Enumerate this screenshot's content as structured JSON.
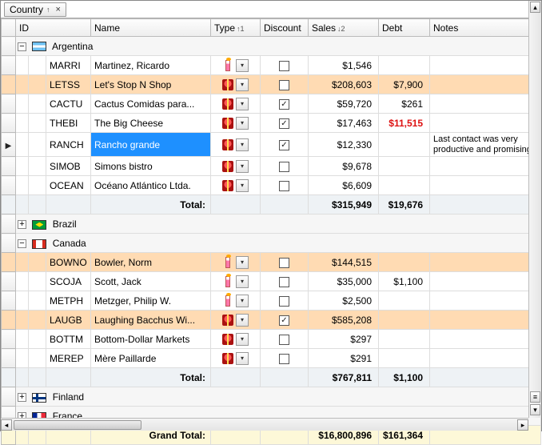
{
  "groupby": {
    "label": "Country",
    "sort_glyph": "↑",
    "close_glyph": "×"
  },
  "columns": {
    "id": "ID",
    "name": "Name",
    "type": "Type",
    "discount": "Discount",
    "sales": "Sales",
    "debt": "Debt",
    "notes": "Notes",
    "type_sort": "↑1",
    "sales_sort": "↓2"
  },
  "groups": {
    "argentina": {
      "name": "Argentina",
      "expanded": true
    },
    "brazil": {
      "name": "Brazil",
      "expanded": false
    },
    "canada": {
      "name": "Canada",
      "expanded": true
    },
    "finland": {
      "name": "Finland",
      "expanded": false
    },
    "france": {
      "name": "France",
      "expanded": false
    }
  },
  "rows": {
    "ar": [
      {
        "id": "MARRI",
        "name": "Martinez, Ricardo",
        "type": "candle",
        "discount": false,
        "sales": "$1,546",
        "debt": "",
        "notes": ""
      },
      {
        "id": "LETSS",
        "name": "Let's Stop N Shop",
        "type": "gift",
        "discount": false,
        "sales": "$208,603",
        "debt": "$7,900",
        "notes": ""
      },
      {
        "id": "CACTU",
        "name": "Cactus Comidas para...",
        "type": "gift",
        "discount": true,
        "sales": "$59,720",
        "debt": "$261",
        "notes": ""
      },
      {
        "id": "THEBI",
        "name": "The Big Cheese",
        "type": "gift",
        "discount": true,
        "sales": "$17,463",
        "debt": "$11,515",
        "debt_red": true,
        "notes": ""
      },
      {
        "id": "RANCH",
        "name": "Rancho grande",
        "type": "gift",
        "discount": true,
        "sales": "$12,330",
        "debt": "",
        "notes": "Last contact was very productive and promising",
        "selected": true
      },
      {
        "id": "SIMOB",
        "name": "Simons bistro",
        "type": "gift",
        "discount": false,
        "sales": "$9,678",
        "debt": "",
        "notes": ""
      },
      {
        "id": "OCEAN",
        "name": "Océano Atlántico Ltda.",
        "type": "gift",
        "discount": false,
        "sales": "$6,609",
        "debt": "",
        "notes": ""
      }
    ],
    "ca": [
      {
        "id": "BOWNO",
        "name": "Bowler, Norm",
        "type": "candle",
        "discount": false,
        "sales": "$144,515",
        "debt": "",
        "notes": ""
      },
      {
        "id": "SCOJA",
        "name": "Scott, Jack",
        "type": "candle",
        "discount": false,
        "sales": "$35,000",
        "debt": "$1,100",
        "notes": ""
      },
      {
        "id": "METPH",
        "name": "Metzger, Philip W.",
        "type": "candle",
        "discount": false,
        "sales": "$2,500",
        "debt": "",
        "notes": ""
      },
      {
        "id": "LAUGB",
        "name": "Laughing Bacchus Wi...",
        "type": "gift",
        "discount": true,
        "sales": "$585,208",
        "debt": "",
        "notes": ""
      },
      {
        "id": "BOTTM",
        "name": "Bottom-Dollar Markets",
        "type": "gift",
        "discount": false,
        "sales": "$297",
        "debt": "",
        "notes": ""
      },
      {
        "id": "MEREP",
        "name": "Mère Paillarde",
        "type": "gift",
        "discount": false,
        "sales": "$291",
        "debt": "",
        "notes": ""
      }
    ]
  },
  "totals": {
    "label": "Total:",
    "ar": {
      "sales": "$315,949",
      "debt": "$19,676"
    },
    "ca": {
      "sales": "$767,811",
      "debt": "$1,100"
    }
  },
  "grand_total": {
    "label": "Grand Total:",
    "sales": "$16,800,896",
    "debt": "$161,364"
  }
}
